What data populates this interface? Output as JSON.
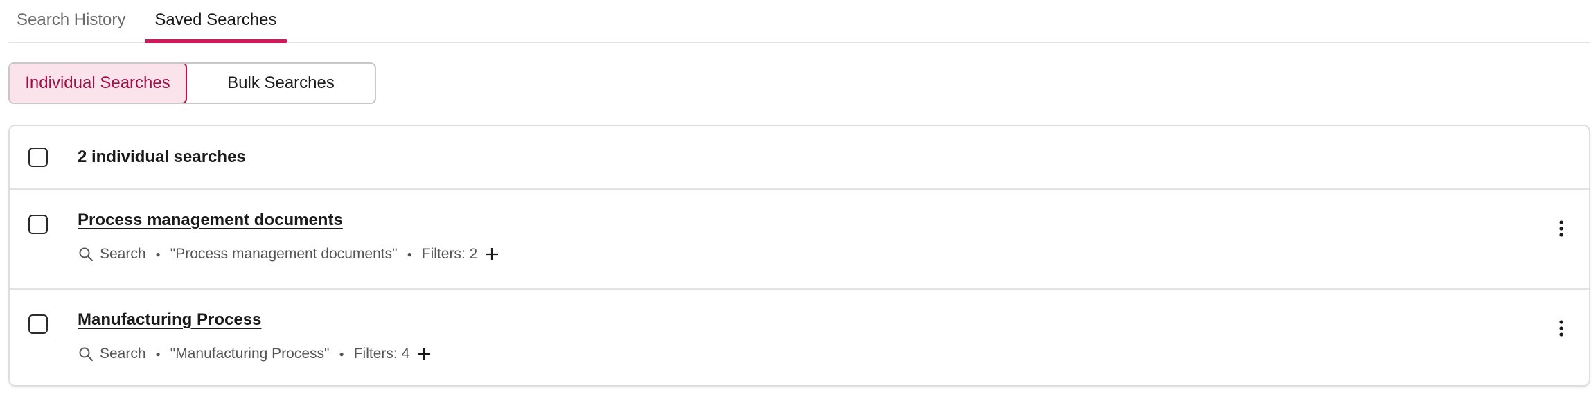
{
  "tabs": [
    {
      "label": "Search History",
      "active": false
    },
    {
      "label": "Saved Searches",
      "active": true
    }
  ],
  "toggle": {
    "individual_label": "Individual Searches",
    "bulk_label": "Bulk Searches",
    "selected": "Individual Searches"
  },
  "list": {
    "header": "2 individual searches",
    "items": [
      {
        "title": "Process management documents",
        "type": "Search",
        "query": "\"Process management documents\"",
        "filters": "Filters: 2"
      },
      {
        "title": "Manufacturing Process",
        "type": "Search",
        "query": "\"Manufacturing Process\"",
        "filters": "Filters: 4"
      }
    ]
  },
  "colors": {
    "accent": "#d6165c",
    "toggle_active_bg": "#fbe3ec",
    "toggle_active_text": "#a01247"
  },
  "icons": {
    "search": "search-icon",
    "add": "plus-icon",
    "menu": "more-vertical-icon"
  }
}
